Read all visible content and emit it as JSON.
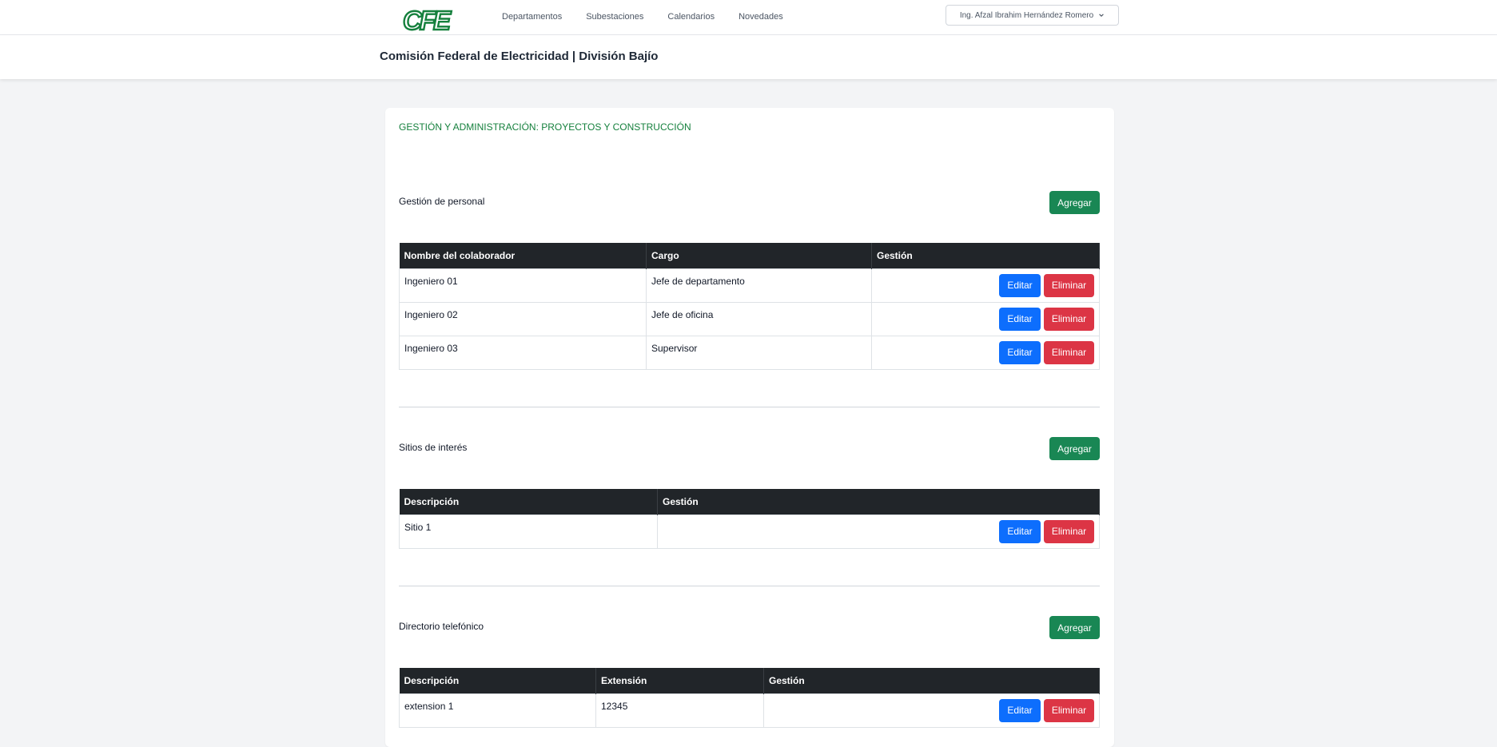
{
  "app": {
    "logo_text": "CFE",
    "user_menu_label": "Ing. Afzal Ibrahim Hernández Romero"
  },
  "nav": {
    "items": [
      {
        "label": "Departamentos"
      },
      {
        "label": "Subestaciones"
      },
      {
        "label": "Calendarios"
      },
      {
        "label": "Novedades"
      }
    ]
  },
  "header": {
    "title": "Comisión Federal de Electricidad | División Bajío"
  },
  "page": {
    "section_title": "GESTIÓN Y ADMINISTRACIÓN: PROYECTOS Y CONSTRUCCIÓN",
    "labels": {
      "add": "Agregar",
      "edit": "Editar",
      "delete": "Eliminar"
    }
  },
  "personal": {
    "title": "Gestión de personal",
    "columns": [
      "Nombre del colaborador",
      "Cargo",
      "Gestión"
    ],
    "rows": [
      {
        "name": "Ingeniero 01",
        "role": "Jefe de departamento"
      },
      {
        "name": "Ingeniero 02",
        "role": "Jefe de oficina"
      },
      {
        "name": "Ingeniero 03",
        "role": "Supervisor"
      }
    ]
  },
  "sitios": {
    "title": "Sitios de interés",
    "columns": [
      "Descripción",
      "Gestión"
    ],
    "rows": [
      {
        "description": "Sitio 1"
      }
    ]
  },
  "directorio": {
    "title": "Directorio telefónico",
    "columns": [
      "Descripción",
      "Extensión",
      "Gestión"
    ],
    "rows": [
      {
        "description": "extension 1",
        "extension": "12345"
      }
    ]
  },
  "colors": {
    "accent_green": "#198754",
    "title_green": "#15803d",
    "edit_blue": "#0d6efd",
    "delete_red": "#dc3545",
    "table_header": "#212529"
  }
}
